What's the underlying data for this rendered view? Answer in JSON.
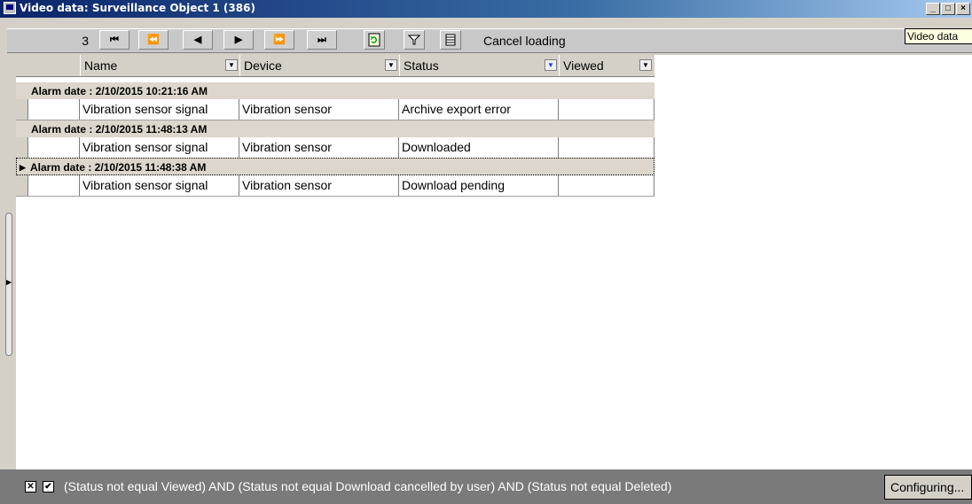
{
  "window": {
    "title": "Video data: Surveillance  Object 1 (386)",
    "minimize": "_",
    "maximize": "□",
    "close": "×"
  },
  "toolbar": {
    "counter": "3",
    "first": "⏮",
    "prev_page": "⏪",
    "prev": "◀",
    "next": "▶",
    "next_page": "⏩",
    "last": "⏭",
    "refresh_icon": "refresh-icon",
    "filter_icon": "filter-icon",
    "columns_icon": "columns-icon",
    "cancel_loading": "Cancel loading"
  },
  "tooltip": "Video data",
  "grid": {
    "columns": [
      "Name",
      "Device",
      "Status",
      "Viewed"
    ],
    "groups": [
      {
        "label": "Alarm date : 2/10/2015 10:21:16 AM",
        "rows": [
          [
            "Vibration sensor signal",
            "Vibration sensor",
            "Archive export error",
            ""
          ]
        ]
      },
      {
        "label": "Alarm date : 2/10/2015 11:48:13 AM",
        "rows": [
          [
            "Vibration sensor signal",
            "Vibration sensor",
            "Downloaded",
            ""
          ]
        ]
      },
      {
        "label": "Alarm date : 2/10/2015 11:48:38 AM",
        "rows": [
          [
            "Vibration sensor signal",
            "Vibration sensor",
            "Download pending",
            ""
          ]
        ]
      }
    ]
  },
  "statusbar": {
    "filter": "(Status not equal Viewed) AND (Status not equal Download cancelled by user) AND (Status not equal Deleted)",
    "configuring": "Configuring...",
    "clear_mark": "✕",
    "check_mark": "✔"
  },
  "colors": {
    "title_start": "#0a246a",
    "title_end": "#a6caf0",
    "status_bg": "#7a7a7a",
    "status_arrow": "#2040ff"
  }
}
